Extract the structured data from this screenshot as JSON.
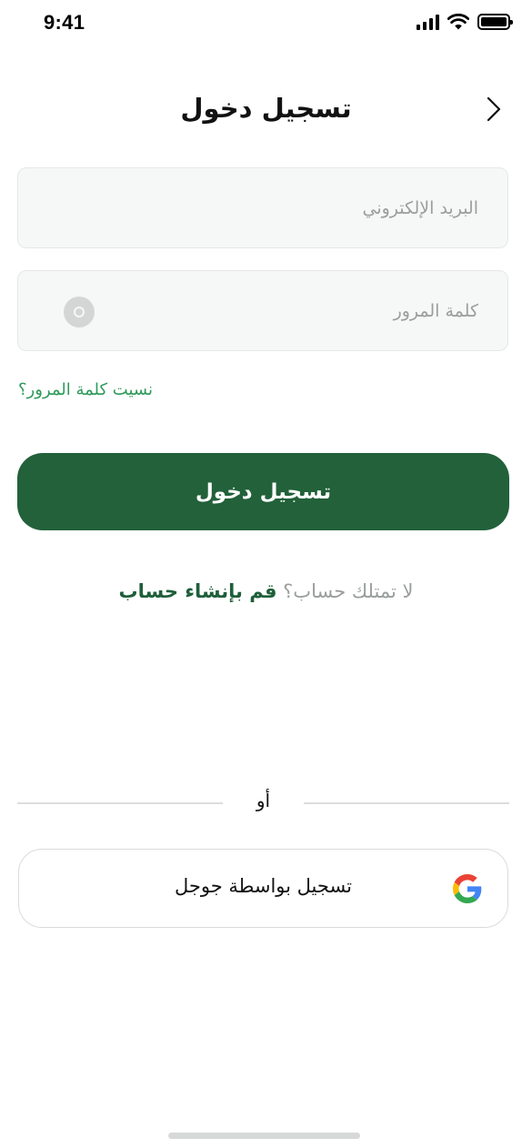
{
  "status_bar": {
    "time": "9:41"
  },
  "header": {
    "title": "تسجيل دخول",
    "back_icon": "chevron-right-icon"
  },
  "form": {
    "email": {
      "placeholder": "البريد الإلكتروني",
      "value": ""
    },
    "password": {
      "placeholder": "كلمة المرور",
      "value": "",
      "toggle_icon": "eye-icon"
    },
    "forgot_password": "نسيت كلمة المرور؟",
    "login_button": "تسجيل دخول"
  },
  "signup": {
    "prompt": "لا تمتلك حساب؟",
    "link": "قم بإنشاء حساب"
  },
  "divider": {
    "text": "أو"
  },
  "google": {
    "label": "تسجيل بواسطة جوجل",
    "icon": "google-icon"
  },
  "colors": {
    "primary": "#22613a",
    "link_green": "#2e9a5a",
    "field_bg": "#f6f7f7",
    "placeholder": "#9a9e9e"
  }
}
